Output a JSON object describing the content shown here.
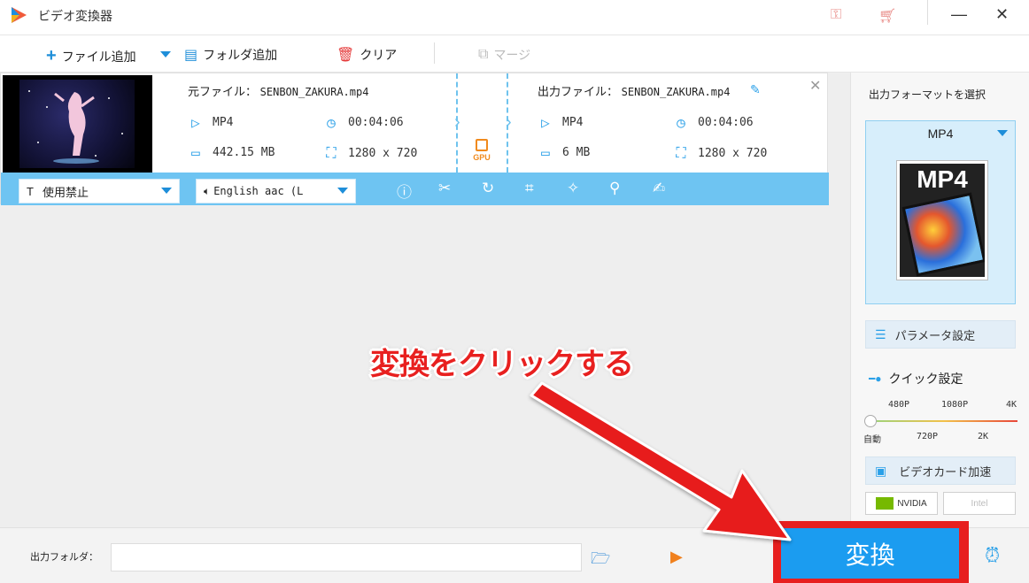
{
  "app": {
    "title": "ビデオ変換器"
  },
  "toolbar": {
    "add_file": "ファイル追加",
    "add_folder": "フォルダ追加",
    "clear": "クリア",
    "merge": "マージ"
  },
  "item": {
    "source_label": "元ファイル：",
    "source_name": "SENBON_ZAKURA.mp4",
    "source_format": "MP4",
    "source_duration": "00:04:06",
    "source_size": "442.15 MB",
    "source_resolution": "1280 x 720",
    "output_label": "出力ファイル：",
    "output_name": "SENBON_ZAKURA.mp4",
    "output_format": "MP4",
    "output_duration": "00:04:06",
    "output_size": "6 MB",
    "output_resolution": "1280 x 720",
    "gpu_label": "GPU",
    "subtitle": "使用禁止",
    "audio": "English aac (L"
  },
  "panel": {
    "title": "出力フォーマットを選択",
    "format": "MP4",
    "format_image_text": "MP4",
    "param_settings": "パラメータ設定",
    "quick_settings": "クイック設定",
    "quality_top": [
      "480P",
      "1080P",
      "4K"
    ],
    "quality_bottom": [
      "自動",
      "720P",
      "2K"
    ],
    "gpu_accel": "ビデオカード加速",
    "nvidia": "NVIDIA",
    "intel": "Intel"
  },
  "bottom": {
    "output_folder_label": "出力フォルダ：",
    "output_folder_value": "",
    "convert": "変換"
  },
  "annotation": {
    "text": "変換をクリックする",
    "color": "#e8201f"
  },
  "colors": {
    "accent": "#1b9cf0",
    "bar": "#6ec4f2",
    "annotation_red": "#e71f1f"
  }
}
